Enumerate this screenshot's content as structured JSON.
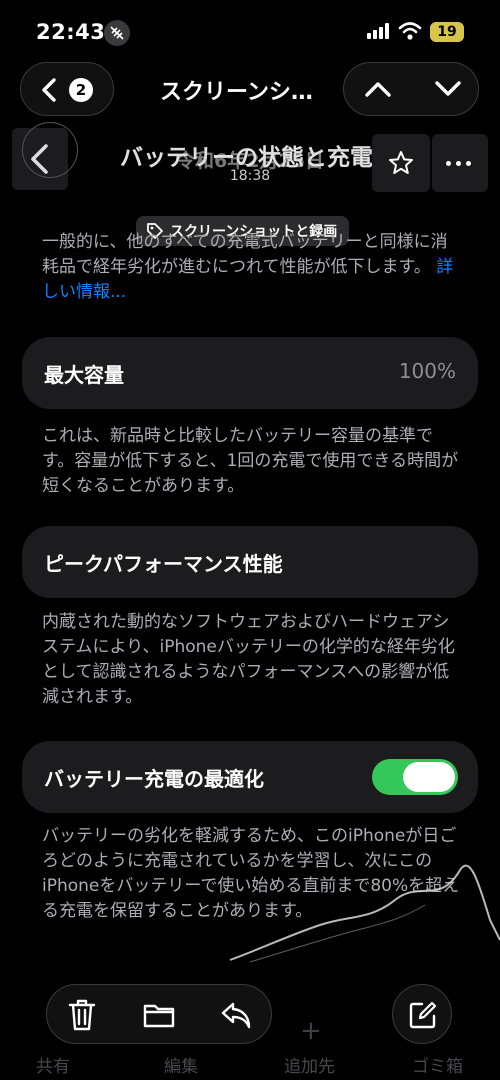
{
  "status_bar": {
    "time": "22:43",
    "battery": "19",
    "focus_icon": "focus-mute-icon",
    "colors": {
      "battery": "#d7c44a"
    }
  },
  "viewer": {
    "back_count": "2",
    "title": "スクリーンシ…"
  },
  "screenshot_header": {
    "title": "バッテリーの状態と充電",
    "date": "令和6年2月25日",
    "time": "18:38"
  },
  "tag": {
    "label": "スクリーンショットと録画"
  },
  "settings": {
    "intro_text": "一般的に、他のすべての充電式バッテリーと同様に消耗品で経年劣化が進むにつれて性能が低下します。",
    "intro_link": "詳しい情報...",
    "max_capacity": {
      "label": "最大容量",
      "value": "100%"
    },
    "max_capacity_desc": "これは、新品時と比較したバッテリー容量の基準です。容量が低下すると、1回の充電で使用できる時間が短くなることがあります。",
    "peak_performance": {
      "label": "ピークパフォーマンス性能"
    },
    "peak_performance_desc": "内蔵された動的なソフトウェアおよびハードウェアシステムにより、iPhoneバッテリーの化学的な経年劣化として認識されるようなパフォーマンスへの影響が低減されます。",
    "optimized_charging": {
      "label": "バッテリー充電の最適化",
      "enabled": true
    },
    "optimized_charging_desc": "バッテリーの劣化を軽減するため、このiPhoneが日ごろどのように充電されているかを学習し、次にこのiPhoneをバッテリーで使い始める直前まで80%を超える充電を保留することがあります。",
    "colors": {
      "toggle_on": "#34c759",
      "link": "#0a84ff",
      "card": "#1c1c1e"
    }
  },
  "ghost_tabs": {
    "share": "共有",
    "edit": "編集",
    "add_to": "追加先",
    "trash": "ゴミ箱"
  },
  "toolbar": {
    "icons": [
      "trash-icon",
      "folder-icon",
      "reply-icon",
      "markup-icon"
    ]
  }
}
